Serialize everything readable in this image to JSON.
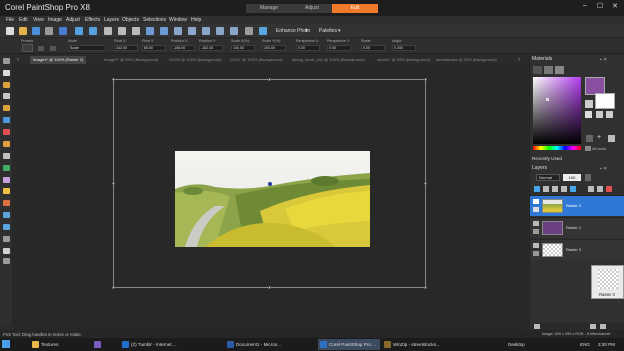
{
  "app": {
    "title": "Corel PaintShop Pro X8",
    "workspace_tabs": [
      "Manage",
      "Adjust",
      "Edit"
    ],
    "active_workspace": "Edit",
    "accent": "#f07a2a"
  },
  "menu": [
    "File",
    "Edit",
    "View",
    "Image",
    "Adjust",
    "Effects",
    "Layers",
    "Objects",
    "Selections",
    "Window",
    "Help"
  ],
  "std_toolbar": {
    "enhance_photo": "Enhance Photo",
    "palettes": "Palettes"
  },
  "tool_options": {
    "presets_label": "Presets",
    "mode_label": "Mode",
    "mode_value": "Scale",
    "fields": [
      {
        "label": "Pivot X:",
        "value": "342.00"
      },
      {
        "label": "Pivot Y:",
        "value": "66.50"
      },
      {
        "label": "Position X:",
        "value": "-156.00"
      },
      {
        "label": "Position Y:",
        "value": "-162.00"
      },
      {
        "label": "Scale X(%):",
        "value": "100.00"
      },
      {
        "label": "Scale Y(%):",
        "value": "100.00"
      },
      {
        "label": "Perspective X:",
        "value": "0.00"
      },
      {
        "label": "Perspective Y:",
        "value": "0.00"
      },
      {
        "label": "Shear:",
        "value": "0.00"
      },
      {
        "label": "Angle:",
        "value": "0.000"
      }
    ]
  },
  "doc_tabs": [
    "Image1* @ 100% (Raster 2)",
    "Image7* @ 59% (Background)",
    "DOX6 @ 100% (Background)",
    "DOX7 @ 100% (Background)",
    "spring_stock_011 @ 100% (Background)",
    "sheet1* @ 59% (Background)",
    "streetstocks @ 34% (Background)"
  ],
  "materials": {
    "title": "Materials",
    "recently_used": "Recently Used",
    "all_tools": "All tools",
    "fg_color": "#8b4fa1"
  },
  "layers": {
    "title": "Layers",
    "blend_mode": "Normal",
    "opacity": "100",
    "rows": [
      {
        "name": "Raster 2",
        "selected": true
      },
      {
        "name": "Raster 1",
        "selected": false
      },
      {
        "name": "Raster 3",
        "selected": false
      }
    ],
    "float_thumb_label": "Raster 3"
  },
  "status": {
    "left": "Pick Tool: Drag handles to resize or rotate.",
    "right": "Image: 500 x 250 x RGB - 8 bits/channel"
  },
  "taskbar": {
    "items": [
      {
        "label": "Textures",
        "color": "#e8b84a",
        "active": false
      },
      {
        "label": "",
        "color": "#7a5cc0",
        "active": false
      },
      {
        "label": "(2) Tumblr - Internet ...",
        "color": "#1f6fcf",
        "active": false
      },
      {
        "label": "Document1 - Micros...",
        "color": "#2b5aa8",
        "active": false
      },
      {
        "label": "Corel PaintShop Pro ...",
        "color": "#2d6fc0",
        "active": true
      },
      {
        "label": "WinZip - streetstocks...",
        "color": "#8a6a2a",
        "active": false
      }
    ],
    "desktop": "Desktop",
    "lang": "ENG",
    "time": "3:30 PM"
  }
}
